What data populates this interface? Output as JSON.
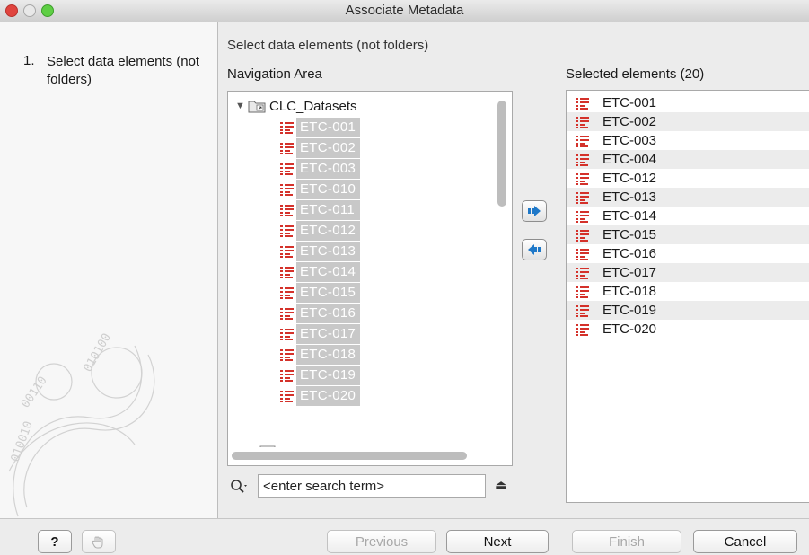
{
  "window": {
    "title": "Associate Metadata"
  },
  "steps": [
    {
      "number": "1.",
      "label": "Select data elements (not folders)"
    }
  ],
  "main": {
    "title": "Select data elements (not folders)",
    "navigation_label": "Navigation Area",
    "selected_label": "Selected elements (20)"
  },
  "navigation_tree": {
    "root_label": "CLC_Datasets",
    "items": [
      "ETC-001",
      "ETC-002",
      "ETC-003",
      "ETC-010",
      "ETC-011",
      "ETC-012",
      "ETC-013",
      "ETC-014",
      "ETC-015",
      "ETC-016",
      "ETC-017",
      "ETC-018",
      "ETC-019",
      "ETC-020"
    ]
  },
  "search": {
    "value": "<enter search term>"
  },
  "selected_elements": [
    "ETC-001",
    "ETC-002",
    "ETC-003",
    "ETC-004",
    "ETC-012",
    "ETC-013",
    "ETC-014",
    "ETC-015",
    "ETC-016",
    "ETC-017",
    "ETC-018",
    "ETC-019",
    "ETC-020"
  ],
  "buttons": {
    "help": "?",
    "previous": "Previous",
    "next": "Next",
    "finish": "Finish",
    "cancel": "Cancel"
  },
  "colors": {
    "sequence_icon": "#d4312a",
    "selection_highlight": "#c8c8c8",
    "add_arrow": "#1e78c8"
  },
  "icons": {
    "add": "arrow-right-icon",
    "remove": "arrow-left-icon",
    "sequence": "sequence-list-icon",
    "folder": "folder-icon",
    "search": "search-icon",
    "eject": "eject-icon"
  }
}
